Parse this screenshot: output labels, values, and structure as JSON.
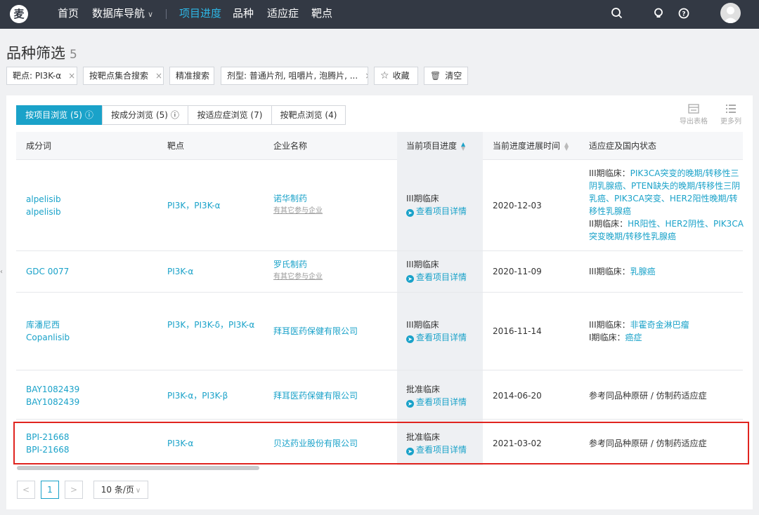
{
  "nav": {
    "logo": "麦",
    "items": [
      "首页",
      "数据库导航",
      "项目进度",
      "品种",
      "适应症",
      "靶点"
    ],
    "dropdown_caret": "∨"
  },
  "page": {
    "title": "品种筛选",
    "count": "5"
  },
  "filters": [
    {
      "label": "靶点: PI3K-α",
      "close": "×"
    },
    {
      "label": "按靶点集合搜索",
      "close": "×"
    },
    {
      "label": "精准搜索"
    },
    {
      "label": "剂型: 普通片剂, 咀嚼片, 泡腾片, ...",
      "close": "×"
    },
    {
      "label": "收藏"
    },
    {
      "label": "清空"
    }
  ],
  "tabs": [
    "按项目浏览 (5)",
    "按成分浏览 (5)",
    "按适应症浏览 (7)",
    "按靶点浏览 (4)"
  ],
  "tools": {
    "export": "导出表格",
    "more": "更多列"
  },
  "table": {
    "headers": [
      "成分词",
      "靶点",
      "企业名称",
      "当前项目进度",
      "当前进度进展时间",
      "适应症及国内状态"
    ],
    "detail_label": "查看项目详情",
    "other_companies": "有其它参与企业",
    "rows": [
      {
        "names": [
          "alpelisib",
          "alpelisib"
        ],
        "targets": "PI3K，PI3K-α",
        "company": "诺华制药",
        "progress": "III期临床",
        "date": "2020-12-03",
        "indications": [
          {
            "label": "III期临床：",
            "text": "PIK3CA突变的晚期/转移性三阴乳腺癌、PTEN缺失的晚期/转移性三阴乳癌、PIK3CA突变、HER2阳性晚期/转移性乳腺癌"
          },
          {
            "label": "II期临床：",
            "text": "HR阳性、HER2阴性、PIK3CA突变晚期/转移性乳腺癌"
          }
        ]
      },
      {
        "names": [
          "GDC 0077"
        ],
        "targets": "PI3K-α",
        "company": "罗氏制药",
        "progress": "III期临床",
        "date": "2020-11-09",
        "indications": [
          {
            "label": "III期临床：",
            "text": "乳腺癌"
          }
        ]
      },
      {
        "names": [
          "库潘尼西",
          "Copanlisib"
        ],
        "targets": "PI3K，PI3K-δ，PI3K-α",
        "company": "拜耳医药保健有限公司",
        "progress": "III期临床",
        "date": "2016-11-14",
        "indications": [
          {
            "label": "III期临床：",
            "text": "非霍奇金淋巴瘤"
          },
          {
            "label": "I期临床：",
            "text": "癌症"
          }
        ]
      },
      {
        "names": [
          "BAY1082439",
          "BAY1082439"
        ],
        "targets": "PI3K-α，PI3K-β",
        "company": "拜耳医药保健有限公司",
        "progress": "批准临床",
        "date": "2014-06-20",
        "plain_indication": "参考同品种原研 / 仿制药适应症"
      },
      {
        "names": [
          "BPI-21668",
          "BPI-21668"
        ],
        "targets": "PI3K-α",
        "company": "贝达药业股份有限公司",
        "progress": "批准临床",
        "date": "2021-03-02",
        "plain_indication": "参考同品种原研 / 仿制药适应症"
      }
    ]
  },
  "pager": {
    "prev": "<",
    "page": "1",
    "next": ">",
    "per_page": "10 条/页"
  }
}
